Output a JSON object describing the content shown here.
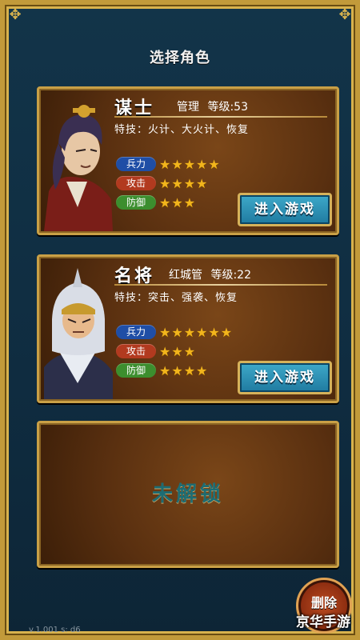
{
  "screen": {
    "title": "选择角色"
  },
  "characters": [
    {
      "name": "谋士",
      "role": "管理",
      "level": "等级:53",
      "skill": "特技：火计、大火计、恢复",
      "stats": [
        {
          "label": "兵力",
          "stars": 5,
          "pill_color": "#1f4ea6"
        },
        {
          "label": "攻击",
          "stars": 4,
          "pill_color": "#b23a1f"
        },
        {
          "label": "防御",
          "stars": 3,
          "pill_color": "#3c8e2e"
        }
      ],
      "enter_label": "进入游戏"
    },
    {
      "name": "名将",
      "role": "红城管",
      "level": "等级:22",
      "skill": "特技：突击、强袭、恢复",
      "stats": [
        {
          "label": "兵力",
          "stars": 6,
          "pill_color": "#1f4ea6"
        },
        {
          "label": "攻击",
          "stars": 3,
          "pill_color": "#b23a1f"
        },
        {
          "label": "防御",
          "stars": 4,
          "pill_color": "#3c8e2e"
        }
      ],
      "enter_label": "进入游戏"
    }
  ],
  "locked_slot": {
    "label": "未解锁"
  },
  "footer": {
    "delete_label": "删除",
    "version": "v.1.001  s: d6",
    "watermark": "京华手游"
  },
  "colors": {
    "frame_gold": "#c29a3a",
    "background": "#123449",
    "button_teal": "#1f7aa0"
  },
  "icons": {
    "stars": "star-icon",
    "corners": "ornament-icon"
  }
}
